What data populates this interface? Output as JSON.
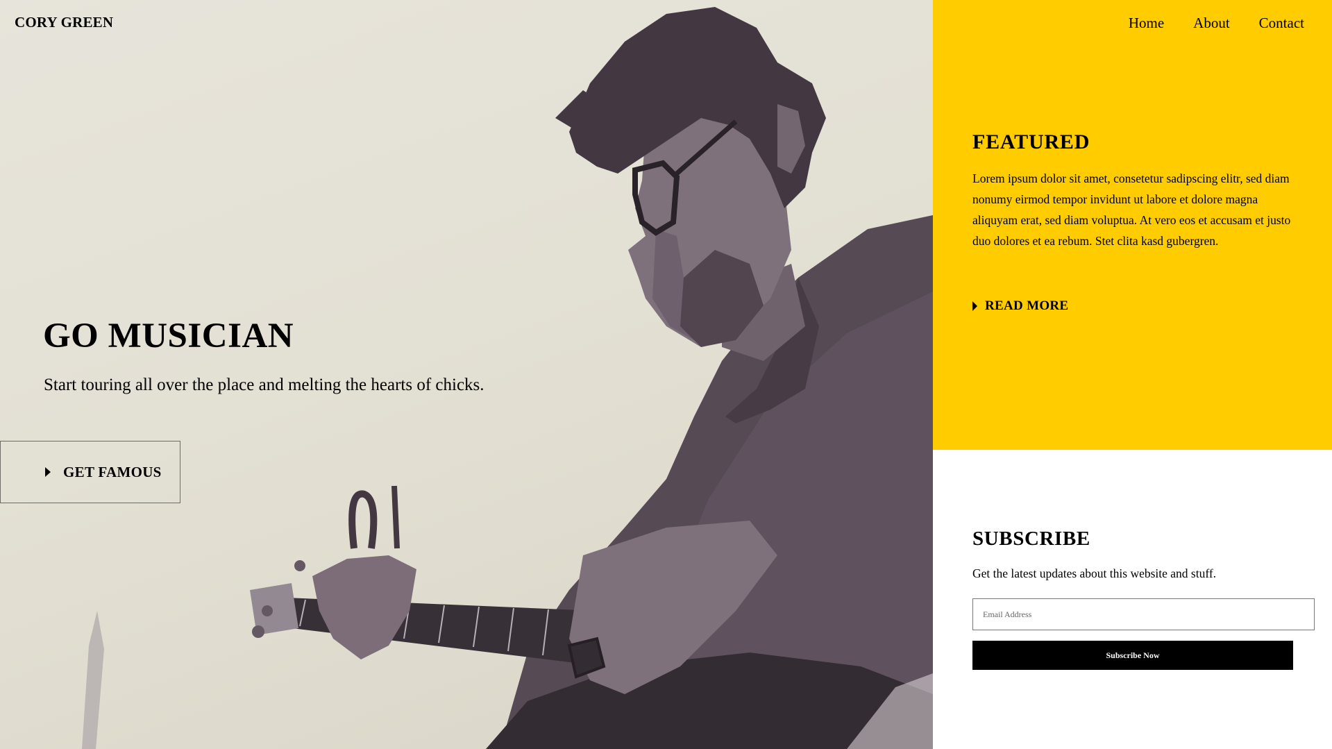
{
  "brand": {
    "name": "CORY GREEN"
  },
  "nav": {
    "items": [
      "Home",
      "About",
      "Contact"
    ]
  },
  "hero": {
    "title": "GO MUSICIAN",
    "subtitle": "Start touring all over the place and melting the hearts of chicks.",
    "cta_label": "GET FAMOUS",
    "photo_icon": "musician-guitar-photo"
  },
  "featured": {
    "heading": "FEATURED",
    "body": "Lorem ipsum dolor sit amet, consetetur sadipscing elitr, sed diam nonumy eirmod tempor invidunt ut labore et dolore magna aliquyam erat, sed diam voluptua. At vero eos et accusam et justo duo dolores et ea rebum. Stet clita kasd gubergren.",
    "link_label": "READ MORE"
  },
  "subscribe": {
    "heading": "SUBSCRIBE",
    "text": "Get the latest updates about this website and stuff.",
    "email_placeholder": "Email Address",
    "button_label": "Subscribe Now"
  },
  "colors": {
    "accent": "#ffcc00",
    "hero_background": "#e4e2d6",
    "photo_tone": "#4c3f4c",
    "button": "#000000"
  }
}
